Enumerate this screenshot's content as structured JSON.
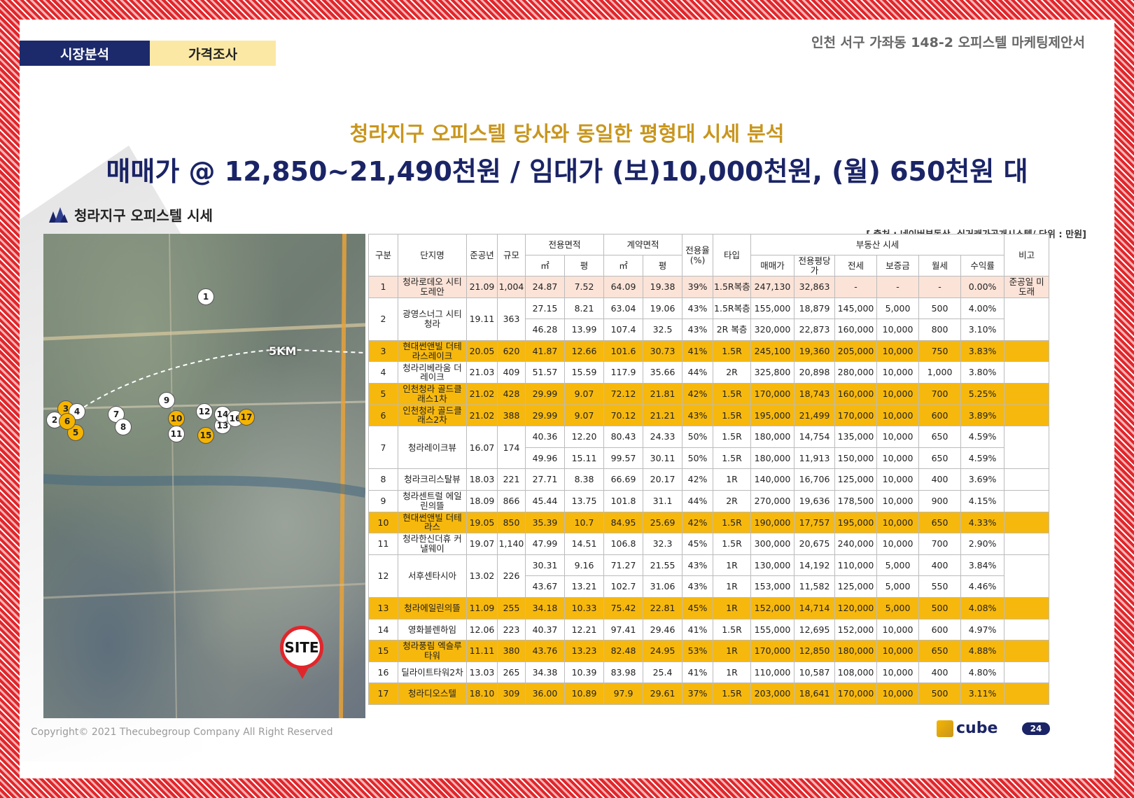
{
  "header": {
    "tab_1": "시장분석",
    "tab_2": "가격조사",
    "doc_title": "인천 서구 가좌동 148-2 오피스텔 마케팅제안서"
  },
  "headline": {
    "line_1": "청라지구 오피스텔 당사와 동일한 평형대 시세 분석",
    "line_2": "매매가 @ 12,850~21,490천원 / 임대가 (보)10,000천원, (월) 650천원 대"
  },
  "section": {
    "title": "청라지구 오피스텔 시세",
    "source": "[ 출처 : 네이버부동산, 실거래가공개시스템/ 단위 : 만원]"
  },
  "map": {
    "distance_label": "5KM",
    "site_label": "SITE"
  },
  "table": {
    "h": {
      "gubun": "구분",
      "name": "단지명",
      "year": "준공년",
      "scale": "규모",
      "area_excl": "전용면적",
      "area_contract": "계약면적",
      "ratio": "전용율 (%)",
      "type": "타입",
      "market": "부동산 시세",
      "note": "비고",
      "sqm": "㎡",
      "pyeong": "평",
      "sqm2": "㎡",
      "pyeong2": "평",
      "sale": "매매가",
      "unit_price": "전용평당가",
      "jeonse": "전세",
      "deposit": "보증금",
      "monthly": "월세",
      "yield": "수익률"
    },
    "rows": [
      {
        "no": "1",
        "name": "청라로데오 시티도레안",
        "year": "21.09",
        "scale": "1,004",
        "style": "pink",
        "note": "준공일 미도래",
        "subs": [
          {
            "sqm": "24.87",
            "py": "7.52",
            "csqm": "64.09",
            "cpy": "19.38",
            "ratio": "39%",
            "type": "1.5R복층",
            "sale": "247,130",
            "unit": "32,863",
            "jeonse": "-",
            "deposit": "-",
            "monthly": "-",
            "yield": "0.00%"
          }
        ]
      },
      {
        "no": "2",
        "name": "광영스너그 시티청라",
        "year": "19.11",
        "scale": "363",
        "style": "",
        "note": "",
        "subs": [
          {
            "sqm": "27.15",
            "py": "8.21",
            "csqm": "63.04",
            "cpy": "19.06",
            "ratio": "43%",
            "type": "1.5R복층",
            "sale": "155,000",
            "unit": "18,879",
            "jeonse": "145,000",
            "deposit": "5,000",
            "monthly": "500",
            "yield": "4.00%"
          },
          {
            "sqm": "46.28",
            "py": "13.99",
            "csqm": "107.4",
            "cpy": "32.5",
            "ratio": "43%",
            "type": "2R 복층",
            "sale": "320,000",
            "unit": "22,873",
            "jeonse": "160,000",
            "deposit": "10,000",
            "monthly": "800",
            "yield": "3.10%"
          }
        ]
      },
      {
        "no": "3",
        "name": "현대썬앤빌 더테라스레이크",
        "year": "20.05",
        "scale": "620",
        "style": "hl",
        "note": "",
        "subs": [
          {
            "sqm": "41.87",
            "py": "12.66",
            "csqm": "101.6",
            "cpy": "30.73",
            "ratio": "41%",
            "type": "1.5R",
            "sale": "245,100",
            "unit": "19,360",
            "jeonse": "205,000",
            "deposit": "10,000",
            "monthly": "750",
            "yield": "3.83%"
          }
        ]
      },
      {
        "no": "4",
        "name": "청라리베라움 더레이크",
        "year": "21.03",
        "scale": "409",
        "style": "",
        "note": "",
        "subs": [
          {
            "sqm": "51.57",
            "py": "15.59",
            "csqm": "117.9",
            "cpy": "35.66",
            "ratio": "44%",
            "type": "2R",
            "sale": "325,800",
            "unit": "20,898",
            "jeonse": "280,000",
            "deposit": "10,000",
            "monthly": "1,000",
            "yield": "3.80%"
          }
        ]
      },
      {
        "no": "5",
        "name": "인천청라 골드클래스1차",
        "year": "21.02",
        "scale": "428",
        "style": "hl",
        "note": "",
        "subs": [
          {
            "sqm": "29.99",
            "py": "9.07",
            "csqm": "72.12",
            "cpy": "21.81",
            "ratio": "42%",
            "type": "1.5R",
            "sale": "170,000",
            "unit": "18,743",
            "jeonse": "160,000",
            "deposit": "10,000",
            "monthly": "700",
            "yield": "5.25%"
          }
        ]
      },
      {
        "no": "6",
        "name": "인천청라 골드클래스2차",
        "year": "21.02",
        "scale": "388",
        "style": "hl",
        "note": "",
        "subs": [
          {
            "sqm": "29.99",
            "py": "9.07",
            "csqm": "70.12",
            "cpy": "21.21",
            "ratio": "43%",
            "type": "1.5R",
            "sale": "195,000",
            "unit": "21,499",
            "jeonse": "170,000",
            "deposit": "10,000",
            "monthly": "600",
            "yield": "3.89%"
          }
        ]
      },
      {
        "no": "7",
        "name": "청라레이크뷰",
        "year": "16.07",
        "scale": "174",
        "style": "",
        "note": "",
        "subs": [
          {
            "sqm": "40.36",
            "py": "12.20",
            "csqm": "80.43",
            "cpy": "24.33",
            "ratio": "50%",
            "type": "1.5R",
            "sale": "180,000",
            "unit": "14,754",
            "jeonse": "135,000",
            "deposit": "10,000",
            "monthly": "650",
            "yield": "4.59%"
          },
          {
            "sqm": "49.96",
            "py": "15.11",
            "csqm": "99.57",
            "cpy": "30.11",
            "ratio": "50%",
            "type": "1.5R",
            "sale": "180,000",
            "unit": "11,913",
            "jeonse": "150,000",
            "deposit": "10,000",
            "monthly": "650",
            "yield": "4.59%"
          }
        ]
      },
      {
        "no": "8",
        "name": "청라크리스탈뷰",
        "year": "18.03",
        "scale": "221",
        "style": "",
        "note": "",
        "subs": [
          {
            "sqm": "27.71",
            "py": "8.38",
            "csqm": "66.69",
            "cpy": "20.17",
            "ratio": "42%",
            "type": "1R",
            "sale": "140,000",
            "unit": "16,706",
            "jeonse": "125,000",
            "deposit": "10,000",
            "monthly": "400",
            "yield": "3.69%"
          }
        ]
      },
      {
        "no": "9",
        "name": "청라센트럴 에일린의뜰",
        "year": "18.09",
        "scale": "866",
        "style": "",
        "note": "",
        "subs": [
          {
            "sqm": "45.44",
            "py": "13.75",
            "csqm": "101.8",
            "cpy": "31.1",
            "ratio": "44%",
            "type": "2R",
            "sale": "270,000",
            "unit": "19,636",
            "jeonse": "178,500",
            "deposit": "10,000",
            "monthly": "900",
            "yield": "4.15%"
          }
        ]
      },
      {
        "no": "10",
        "name": "현대썬앤빌 더테라스",
        "year": "19.05",
        "scale": "850",
        "style": "hl",
        "note": "",
        "subs": [
          {
            "sqm": "35.39",
            "py": "10.7",
            "csqm": "84.95",
            "cpy": "25.69",
            "ratio": "42%",
            "type": "1.5R",
            "sale": "190,000",
            "unit": "17,757",
            "jeonse": "195,000",
            "deposit": "10,000",
            "monthly": "650",
            "yield": "4.33%"
          }
        ]
      },
      {
        "no": "11",
        "name": "청라한신더휴 커낼웨이",
        "year": "19.07",
        "scale": "1,140",
        "style": "",
        "note": "",
        "subs": [
          {
            "sqm": "47.99",
            "py": "14.51",
            "csqm": "106.8",
            "cpy": "32.3",
            "ratio": "45%",
            "type": "1.5R",
            "sale": "300,000",
            "unit": "20,675",
            "jeonse": "240,000",
            "deposit": "10,000",
            "monthly": "700",
            "yield": "2.90%"
          }
        ]
      },
      {
        "no": "12",
        "name": "서후센타시아",
        "year": "13.02",
        "scale": "226",
        "style": "",
        "note": "",
        "subs": [
          {
            "sqm": "30.31",
            "py": "9.16",
            "csqm": "71.27",
            "cpy": "21.55",
            "ratio": "43%",
            "type": "1R",
            "sale": "130,000",
            "unit": "14,192",
            "jeonse": "110,000",
            "deposit": "5,000",
            "monthly": "400",
            "yield": "3.84%"
          },
          {
            "sqm": "43.67",
            "py": "13.21",
            "csqm": "102.7",
            "cpy": "31.06",
            "ratio": "43%",
            "type": "1R",
            "sale": "153,000",
            "unit": "11,582",
            "jeonse": "125,000",
            "deposit": "5,000",
            "monthly": "550",
            "yield": "4.46%"
          }
        ]
      },
      {
        "no": "13",
        "name": "청라에일린의뜰",
        "year": "11.09",
        "scale": "255",
        "style": "hl",
        "note": "",
        "subs": [
          {
            "sqm": "34.18",
            "py": "10.33",
            "csqm": "75.42",
            "cpy": "22.81",
            "ratio": "45%",
            "type": "1R",
            "sale": "152,000",
            "unit": "14,714",
            "jeonse": "120,000",
            "deposit": "5,000",
            "monthly": "500",
            "yield": "4.08%"
          }
        ]
      },
      {
        "no": "14",
        "name": "영화블렌하임",
        "year": "12.06",
        "scale": "223",
        "style": "",
        "note": "",
        "subs": [
          {
            "sqm": "40.37",
            "py": "12.21",
            "csqm": "97.41",
            "cpy": "29.46",
            "ratio": "41%",
            "type": "1.5R",
            "sale": "155,000",
            "unit": "12,695",
            "jeonse": "152,000",
            "deposit": "10,000",
            "monthly": "600",
            "yield": "4.97%"
          }
        ]
      },
      {
        "no": "15",
        "name": "청라풍림 엑슬루타워",
        "year": "11.11",
        "scale": "380",
        "style": "hl",
        "note": "",
        "subs": [
          {
            "sqm": "43.76",
            "py": "13.23",
            "csqm": "82.48",
            "cpy": "24.95",
            "ratio": "53%",
            "type": "1R",
            "sale": "170,000",
            "unit": "12,850",
            "jeonse": "180,000",
            "deposit": "10,000",
            "monthly": "650",
            "yield": "4.88%"
          }
        ]
      },
      {
        "no": "16",
        "name": "딜라이트타워2차",
        "year": "13.03",
        "scale": "265",
        "style": "",
        "note": "",
        "subs": [
          {
            "sqm": "34.38",
            "py": "10.39",
            "csqm": "83.98",
            "cpy": "25.4",
            "ratio": "41%",
            "type": "1R",
            "sale": "110,000",
            "unit": "10,587",
            "jeonse": "108,000",
            "deposit": "10,000",
            "monthly": "400",
            "yield": "4.80%"
          }
        ]
      },
      {
        "no": "17",
        "name": "청라디오스텔",
        "year": "18.10",
        "scale": "309",
        "style": "hl",
        "note": "",
        "subs": [
          {
            "sqm": "36.00",
            "py": "10.89",
            "csqm": "97.9",
            "cpy": "29.61",
            "ratio": "37%",
            "type": "1.5R",
            "sale": "203,000",
            "unit": "18,641",
            "jeonse": "170,000",
            "deposit": "10,000",
            "monthly": "500",
            "yield": "3.11%"
          }
        ]
      }
    ]
  },
  "footer": {
    "copyright": "Copyright© 2021 Thecubegroup Company All Right Reserved",
    "logo_text": "cube",
    "page_number": "24"
  }
}
